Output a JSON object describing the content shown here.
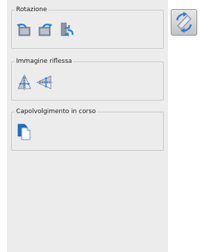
{
  "rotation": {
    "title": "Rotazione",
    "tools": [
      {
        "icon": "rotate-left-icon"
      },
      {
        "icon": "rotate-right-icon"
      },
      {
        "icon": "rotate-free-icon"
      }
    ]
  },
  "mirror": {
    "title": "Immagine riflessa",
    "tools": [
      {
        "icon": "mirror-horizontal-icon"
      },
      {
        "icon": "mirror-vertical-icon"
      }
    ]
  },
  "flip": {
    "title": "Capolvolgimento in corso",
    "tools": [
      {
        "icon": "flip-page-icon"
      }
    ]
  },
  "side_button": {
    "icon": "rotate-object-icon"
  },
  "colors": {
    "panel_bg": "#ececec",
    "accent_blue": "#2f7fd6",
    "icon_gray": "#8c97a6"
  }
}
